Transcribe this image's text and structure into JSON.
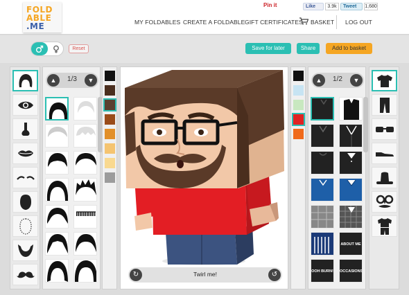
{
  "logo": {
    "line1": "FOLD",
    "line2": "ABLE",
    "line3": ".ME"
  },
  "social": {
    "pinit": "Pin it",
    "like_label": "Like",
    "like_count": "3.9k",
    "tweet_label": "Tweet",
    "tweet_count": "1,680"
  },
  "nav": {
    "my_foldables": "MY FOLDABLES",
    "create": "CREATE A FOLDABLE",
    "gift": "GIFT CERTIFICATES",
    "basket": "BASKET",
    "logout": "LOG OUT"
  },
  "toolbar": {
    "reset": "Reset",
    "save": "Save for later",
    "share": "Share",
    "add_basket": "Add to basket"
  },
  "left_pager": {
    "page": "1/3"
  },
  "right_pager": {
    "page": "1/2"
  },
  "left_swatches": [
    "#111111",
    "#4a2e1e",
    "#5a4030",
    "#9a4c1a",
    "#e2902a",
    "#f5c470",
    "#f9d990",
    "#9c9c9c"
  ],
  "right_swatches": [
    "#111111",
    "#c7e4f3",
    "#c8e8c0",
    "#e02222",
    "#f06a1c"
  ],
  "shirt_tags": {
    "about_me": "ABOUT ME",
    "ooh_burn": "OOH BURN!",
    "occasions": "OCCASIONS"
  },
  "stage": {
    "twirl": "Twirl me!"
  },
  "colors": {
    "accent": "#2bbfb3",
    "orange": "#f5a623",
    "shirt": "#e02222"
  }
}
